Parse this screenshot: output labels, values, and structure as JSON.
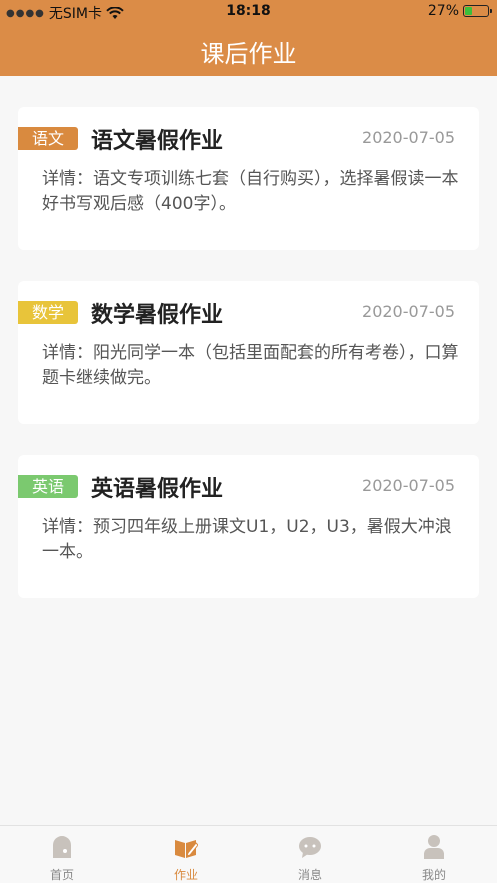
{
  "status_bar": {
    "carrier": "无SIM卡",
    "time": "18:18",
    "battery": "27%"
  },
  "header": {
    "title": "课后作业"
  },
  "colors": {
    "header": "#db8c47",
    "tag_chinese": "#d98a3f",
    "tag_math": "#e8c43a",
    "tag_english": "#7bc96f",
    "tab_active": "#d98a3f"
  },
  "assignments": [
    {
      "tag": "语文",
      "title": "语文暑假作业",
      "date": "2020-07-05",
      "detail": "详情：语文专项训练七套（自行购买），选择暑假读一本好书写观后感（400字）。"
    },
    {
      "tag": "数学",
      "title": "数学暑假作业",
      "date": "2020-07-05",
      "detail": "详情：阳光同学一本（包括里面配套的所有考卷），口算题卡继续做完。"
    },
    {
      "tag": "英语",
      "title": "英语暑假作业",
      "date": "2020-07-05",
      "detail": "详情：预习四年级上册课文U1，U2，U3，暑假大冲浪一本。"
    }
  ],
  "tabbar": {
    "items": [
      {
        "label": "首页",
        "icon": "home-icon"
      },
      {
        "label": "作业",
        "icon": "homework-icon",
        "active": true
      },
      {
        "label": "消息",
        "icon": "message-icon"
      },
      {
        "label": "我的",
        "icon": "profile-icon"
      }
    ]
  }
}
